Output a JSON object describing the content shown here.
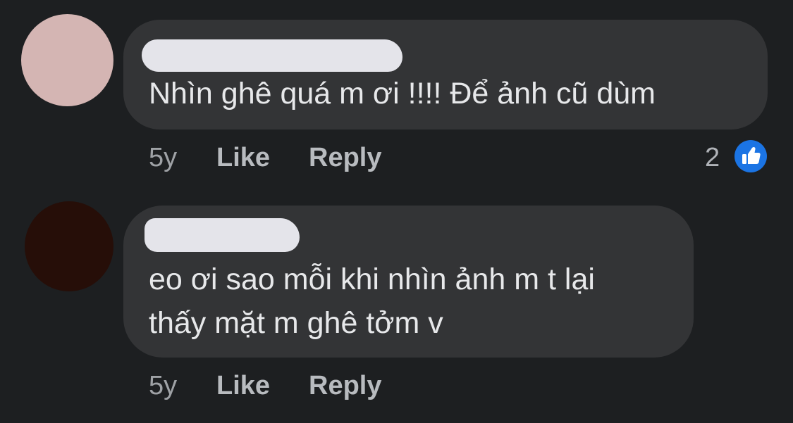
{
  "comments": [
    {
      "text": "Nhìn ghê quá m ơi !!!! Để ảnh cũ dùm",
      "time": "5y",
      "like_label": "Like",
      "reply_label": "Reply",
      "reaction_count": "2",
      "reaction_icon": "like-thumb-icon",
      "avatar_color": "#d4b5b3"
    },
    {
      "text_line1": "eo ơi sao mỗi khi nhìn ảnh m t lại",
      "text_line2": "thấy mặt m ghê tởm v",
      "time": "5y",
      "like_label": "Like",
      "reply_label": "Reply",
      "avatar_color": "#260e08"
    }
  ],
  "colors": {
    "background": "#1d1f21",
    "bubble": "#333436",
    "text": "#e7e8ea",
    "meta": "#b0b3b8",
    "like_blue": "#1b74e4"
  }
}
